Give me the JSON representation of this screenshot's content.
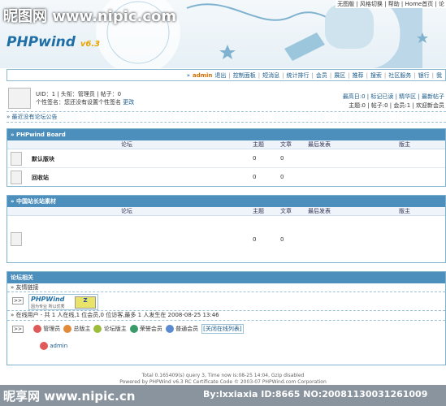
{
  "watermark_top": "昵图网 www.nipic.com",
  "top_links": "无图版 | 风格切换 | 帮助 | Home首页 | 论",
  "logo": {
    "text": "PHPwind",
    "version": "v6.3"
  },
  "nav": {
    "user": "admin",
    "items": [
      "退出",
      "控制面板",
      "短消息",
      "统计排行",
      "会员",
      "展区",
      "推荐",
      "搜索",
      "社区服务",
      "银行",
      "我"
    ]
  },
  "user_info": {
    "line1": "UID：1 | 头衔：管理员 | 帖子：0",
    "line2": "个性签名：您还没有设置个性签名",
    "edit_link": "更改"
  },
  "stats": {
    "line1": "最高日:0 | 标记已读 | 精华区 | 最新帖子",
    "line2": "主题:0 | 帖子:0 | 会员:1 | 欢迎新会员"
  },
  "notice": "最近没有论坛公告",
  "boards": [
    {
      "title": "» PHPwind Board",
      "columns": [
        "论坛",
        "主题",
        "文章",
        "最后发表",
        "版主"
      ],
      "rows": [
        {
          "name": "默认版块",
          "topics": "0",
          "posts": "0"
        },
        {
          "name": "回收站",
          "topics": "0",
          "posts": "0"
        }
      ]
    },
    {
      "title": "» 中国站长站素材",
      "columns": [
        "论坛",
        "主题",
        "文章",
        "最后发表",
        "版主"
      ],
      "rows": [
        {
          "name": "",
          "topics": "0",
          "posts": "0"
        }
      ]
    }
  ],
  "related": {
    "title": "论坛相关",
    "links_label": "友情链接",
    "link_logo": "PHPWind",
    "link_sub": "因为专业 所以优秀",
    "online": "在线用户 - 共 1 人在线,1 位会员,0 位访客,最多 1 人发生在 2008-08-25 13:46",
    "legend": [
      "管理员",
      "总版主",
      "论坛版主",
      "荣誉会员",
      "普通会员"
    ],
    "legend_colors": [
      "#e05a5a",
      "#e08a3a",
      "#9bbd3a",
      "#3a9b6a",
      "#5a8ad0"
    ],
    "close_list": "[关闭在线列表]",
    "online_user": "admin"
  },
  "footer": {
    "line1": "Total 0.165409(s) query 3, Time now is:08-25 14:04, Gzip disabled",
    "line2": "Powered by PHPWind v6.3 RC Certificate Code © 2003-07 PHPWind.com Corporation"
  },
  "watermark_bottom": {
    "left": "昵享网 www.nipic.cn",
    "right": "By:lxxiaxia ID:8665 NO:20081130031261009"
  }
}
